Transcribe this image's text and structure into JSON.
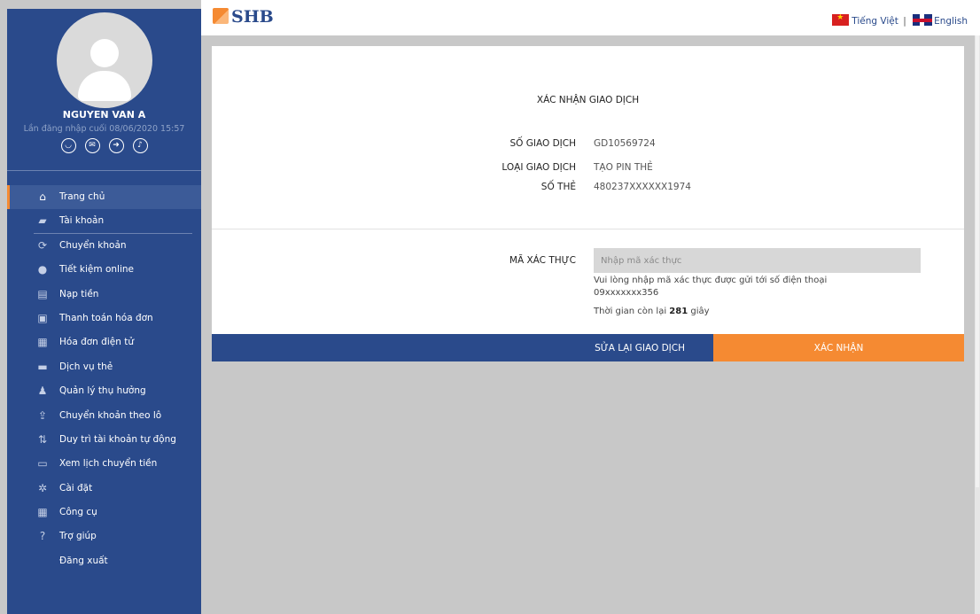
{
  "header": {
    "logo_text": "SHB",
    "lang_vi": "Tiếng Việt",
    "lang_sep": "|",
    "lang_en": "English"
  },
  "user": {
    "name": "NGUYEN VAN A",
    "last_login": "Lần đăng nhập cuối 08/06/2020 15:57",
    "quick_icons": [
      "user-circle-icon",
      "mail-icon",
      "logout-icon",
      "bell-icon"
    ]
  },
  "sidebar": {
    "items": [
      {
        "label": "Trang chủ",
        "icon": "home-icon"
      },
      {
        "label": "Tài khoản",
        "icon": "wallet-icon"
      },
      {
        "label": "Chuyển khoản",
        "icon": "transfer-icon"
      },
      {
        "label": "Tiết kiệm online",
        "icon": "piggy-bank-icon"
      },
      {
        "label": "Nạp tiền",
        "icon": "topup-icon"
      },
      {
        "label": "Thanh toán hóa đơn",
        "icon": "bill-icon"
      },
      {
        "label": "Hóa đơn điện tử",
        "icon": "e-invoice-icon"
      },
      {
        "label": "Dịch vụ thẻ",
        "icon": "card-icon"
      },
      {
        "label": "Quản lý thụ hưởng",
        "icon": "beneficiary-icon"
      },
      {
        "label": "Chuyển khoản theo lô",
        "icon": "batch-upload-icon"
      },
      {
        "label": "Duy trì tài khoản tự động",
        "icon": "auto-sort-icon"
      },
      {
        "label": "Xem lịch chuyển tiền",
        "icon": "calendar-icon"
      },
      {
        "label": "Cài đặt",
        "icon": "gear-icon"
      },
      {
        "label": "Công cụ",
        "icon": "calculator-icon"
      },
      {
        "label": "Trợ giúp",
        "icon": "help-icon"
      },
      {
        "label": "Đăng xuất",
        "icon": ""
      }
    ]
  },
  "confirm": {
    "title": "XÁC NHẬN GIAO DỊCH",
    "fields": [
      {
        "label": "SỐ GIAO DỊCH",
        "value": "GD10569724"
      },
      {
        "label": "LOẠI GIAO DỊCH",
        "value": "TẠO PIN THẺ"
      },
      {
        "label": "SỐ THẺ",
        "value": "480237XXXXXX1974"
      }
    ],
    "otp_label": "MÃ XÁC THỰC",
    "otp_placeholder": "Nhập mã xác thực",
    "otp_note": "Vui lòng nhập mã xác thực được gửi tới số điện thoại 09xxxxxxx356",
    "timer_prefix": "Thời gian còn lại",
    "timer_value": "281",
    "timer_suffix": "giây",
    "edit_button": "SỬA LẠI GIAO DỊCH",
    "confirm_button": "XÁC NHẬN"
  },
  "colors": {
    "sidebar_bg": "#2a4a8b",
    "accent": "#f58a32",
    "content_bg": "#c8c8c8"
  }
}
